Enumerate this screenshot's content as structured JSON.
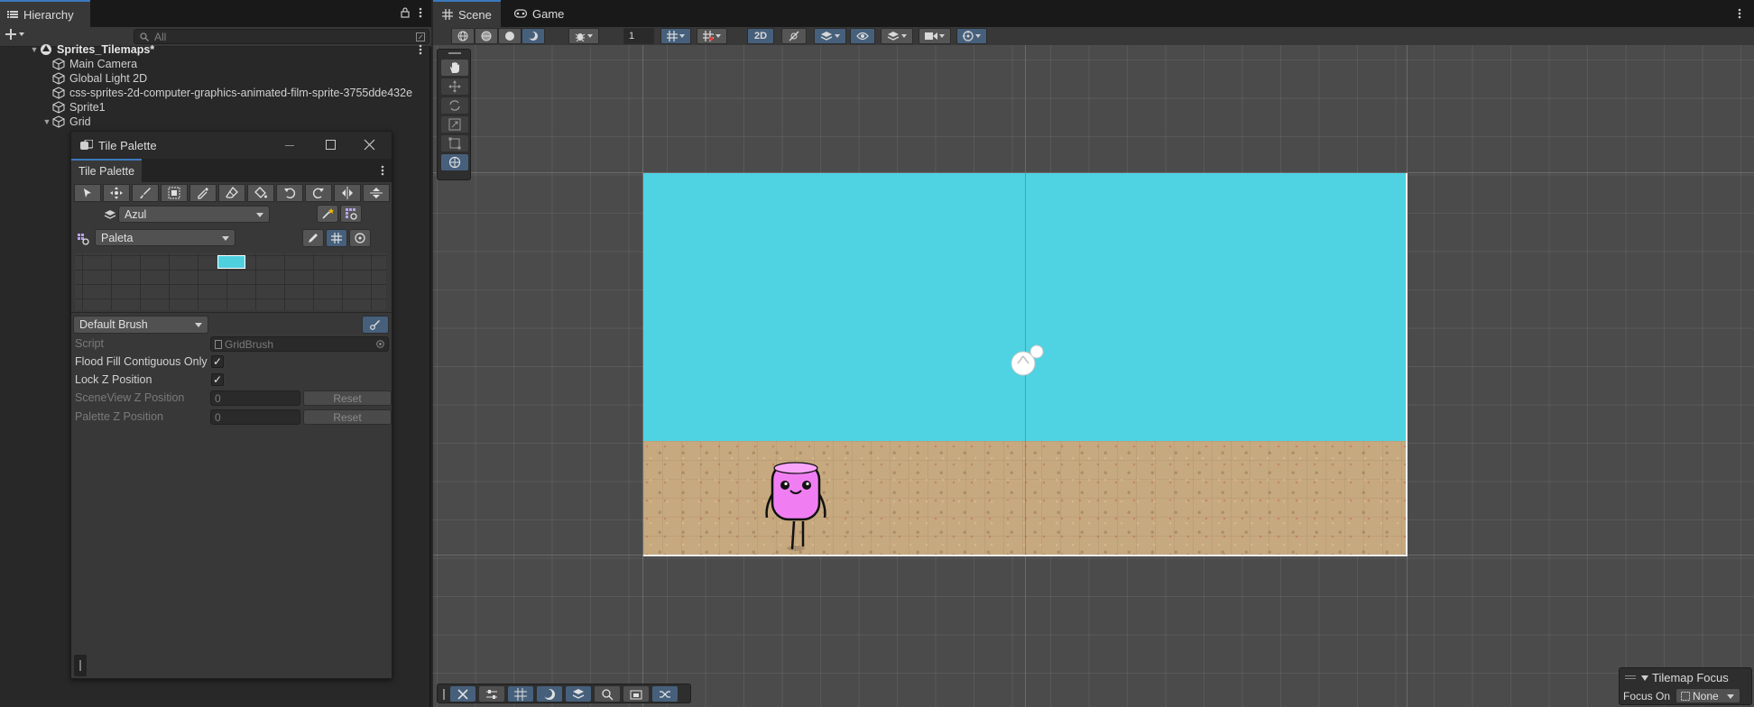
{
  "hierarchy": {
    "tab_label": "Hierarchy",
    "search_placeholder": "All",
    "items": [
      {
        "label": "Sprites_Tilemaps*"
      },
      {
        "label": "Main Camera"
      },
      {
        "label": "Global Light 2D"
      },
      {
        "label": "css-sprites-2d-computer-graphics-animated-film-sprite-3755dde432e"
      },
      {
        "label": "Sprite1"
      },
      {
        "label": "Grid"
      }
    ]
  },
  "tile_palette": {
    "window_title": "Tile Palette",
    "tab_label": "Tile Palette",
    "active_tilemap": "Azul",
    "palette": "Paleta",
    "brush": "Default Brush",
    "painted_tile_color": "#4fd0df",
    "properties": {
      "script_label": "Script",
      "script_value": "GridBrush",
      "flood_fill_label": "Flood Fill Contiguous Only",
      "flood_fill_checked": true,
      "lock_z_label": "Lock Z Position",
      "lock_z_checked": true,
      "sceneview_z_label": "SceneView Z Position",
      "sceneview_z_value": "0",
      "palette_z_label": "Palette Z Position",
      "palette_z_value": "0",
      "reset_label": "Reset"
    }
  },
  "scene": {
    "tab_scene": "Scene",
    "tab_game": "Game",
    "grid_size_value": "1",
    "mode_2d_label": "2D",
    "sky_color": "#4fd3e3",
    "sand_color": "#c7a97f",
    "character_color": "#f07ef2",
    "tilemap_focus": {
      "title": "Tilemap Focus",
      "focus_on_label": "Focus On",
      "focus_on_value": "None"
    }
  }
}
